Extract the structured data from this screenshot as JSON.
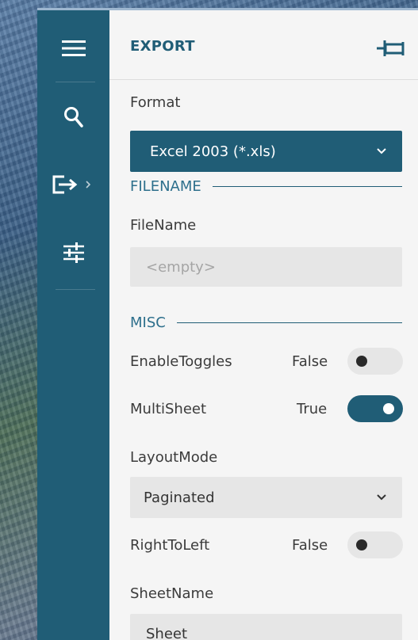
{
  "rail": {
    "items": [
      {
        "icon": "hamburger-menu-icon"
      },
      {
        "icon": "search-icon"
      },
      {
        "icon": "export-icon",
        "active": true
      },
      {
        "icon": "sliders-icon"
      }
    ]
  },
  "header": {
    "title": "EXPORT",
    "pin_icon": "pin-icon"
  },
  "format": {
    "label": "Format",
    "value": "Excel 2003 (*.xls)"
  },
  "sections": {
    "filename": "FILENAME",
    "misc": "MISC"
  },
  "fields": {
    "filename": {
      "label": "FileName",
      "placeholder": "<empty>"
    },
    "enable_toggles": {
      "label": "EnableToggles",
      "value": "False",
      "on": false
    },
    "multisheet": {
      "label": "MultiSheet",
      "value": "True",
      "on": true
    },
    "layout_mode": {
      "label": "LayoutMode",
      "value": "Paginated"
    },
    "right_to_left": {
      "label": "RightToLeft",
      "value": "False",
      "on": false
    },
    "sheet_name": {
      "label": "SheetName",
      "value": "Sheet"
    }
  },
  "colors": {
    "accent": "#205d76",
    "panel_bg": "#f5f5f5",
    "input_bg": "#e6e6e6"
  }
}
